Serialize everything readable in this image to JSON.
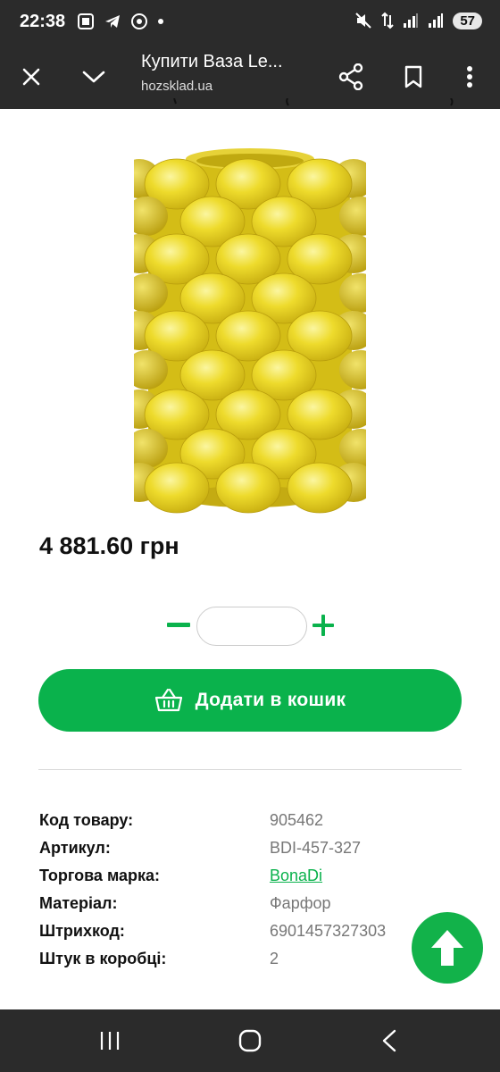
{
  "status_bar": {
    "time": "22:38",
    "battery": "57",
    "icons": [
      "screenshot-icon",
      "telegram-icon",
      "chrome-icon",
      "dot-icon",
      "mute-icon",
      "data-arrows-icon",
      "signal-icon",
      "signal-icon"
    ]
  },
  "toolbar": {
    "title": "Купити Ваза Le...",
    "url": "hozsklad.ua"
  },
  "product": {
    "price": "4 881.60 грн",
    "quantity": "",
    "add_to_cart_label": "Додати в кошик"
  },
  "specs": [
    {
      "label": "Код товару:",
      "value": "905462"
    },
    {
      "label": "Артикул:",
      "value": "BDI-457-327"
    },
    {
      "label": "Торгова марка:",
      "value": "BonaDi"
    },
    {
      "label": "Матеріал:",
      "value": "Фарфор"
    },
    {
      "label": "Штрихкод:",
      "value": "6901457327303"
    },
    {
      "label": "Штук в коробці:",
      "value": "2"
    }
  ],
  "colors": {
    "accent_green": "#0ab24c",
    "bar_dark": "#2b2b2b"
  }
}
